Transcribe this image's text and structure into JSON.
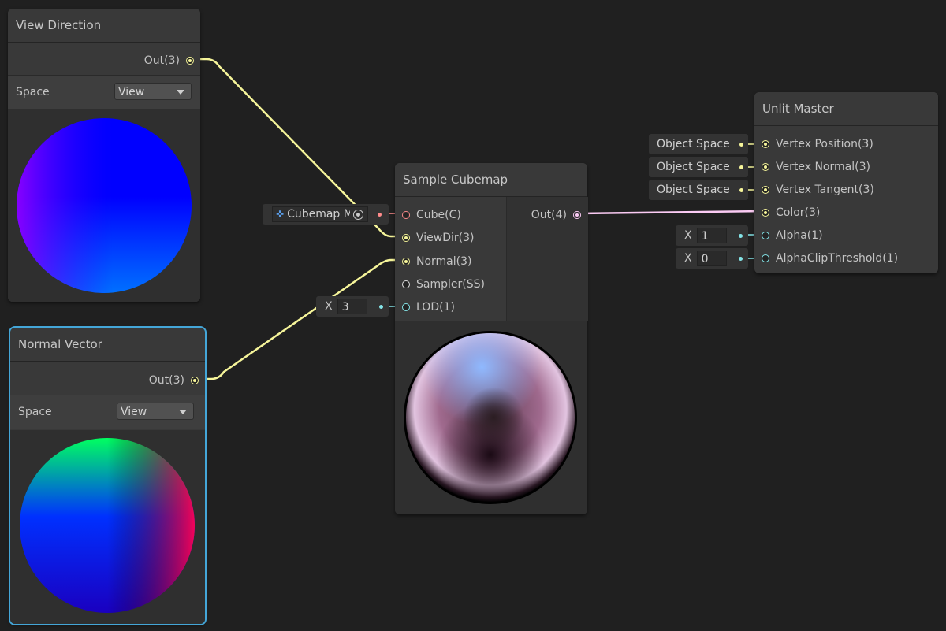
{
  "view_direction": {
    "title": "View Direction",
    "out_label": "Out(3)",
    "space_label": "Space",
    "space_value": "View"
  },
  "normal_vector": {
    "title": "Normal Vector",
    "out_label": "Out(3)",
    "space_label": "Space",
    "space_value": "View"
  },
  "sample_cubemap": {
    "title": "Sample Cubemap",
    "inputs": [
      "Cube(C)",
      "ViewDir(3)",
      "Normal(3)",
      "Sampler(SS)",
      "LOD(1)"
    ],
    "out_label": "Out(4)",
    "cube_input": "Cubemap M",
    "lod_axis": "X",
    "lod_value": "3"
  },
  "unlit_master": {
    "title": "Unlit Master",
    "inputs": [
      "Vertex Position(3)",
      "Vertex Normal(3)",
      "Vertex Tangent(3)",
      "Color(3)",
      "Alpha(1)",
      "AlphaClipThreshold(1)"
    ],
    "space_chips": [
      "Object Space",
      "Object Space",
      "Object Space"
    ],
    "alpha_axis": "X",
    "alpha_value": "1",
    "clip_axis": "X",
    "clip_value": "0"
  },
  "colors": {
    "vector3": "#f6ff9a",
    "vector4": "#fbcbf4",
    "vector1": "#84e4e7",
    "cubemap": "#ff8b8b",
    "sampler": "#dddddd"
  }
}
